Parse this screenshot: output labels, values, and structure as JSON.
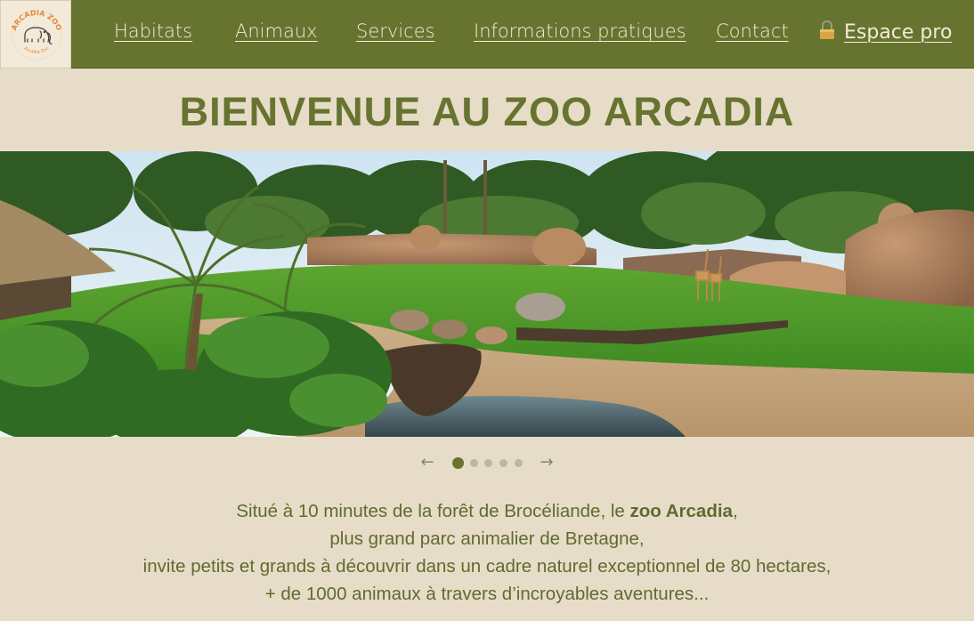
{
  "brand": {
    "logo_text_top": "ARCADIA ZOO",
    "logo_text_bottom": "Arcadia Zoo",
    "logo_icon": "elephant-icon"
  },
  "nav": {
    "links": [
      "Habitats",
      "Animaux",
      "Services",
      "Informations pratiques",
      "Contact"
    ],
    "espace_pro": "Espace pro",
    "espace_pro_icon": "lock-icon"
  },
  "hero": {
    "title": "BIENVENUE AU ZOO ARCADIA",
    "carousel": {
      "slides": 5,
      "active": 1,
      "prev_icon": "arrow-left-icon",
      "next_icon": "arrow-right-icon"
    }
  },
  "intro": {
    "line1_before": "Situé à 10 minutes de la forêt de Brocéliande, le ",
    "line1_bold": "zoo Arcadia",
    "line1_after": ",",
    "line2": "plus grand parc animalier de Bretagne,",
    "line3": "invite petits et grands à découvrir dans un cadre naturel exceptionnel de 80 hectares,",
    "line4": "+ de 1000 animaux à travers d’incroyables aventures..."
  },
  "colors": {
    "nav_bg": "#67742f",
    "page_bg": "#e7dcc8",
    "accent": "#67742f",
    "nav_text": "#f3ead8",
    "logo_text": "#e0893a"
  }
}
